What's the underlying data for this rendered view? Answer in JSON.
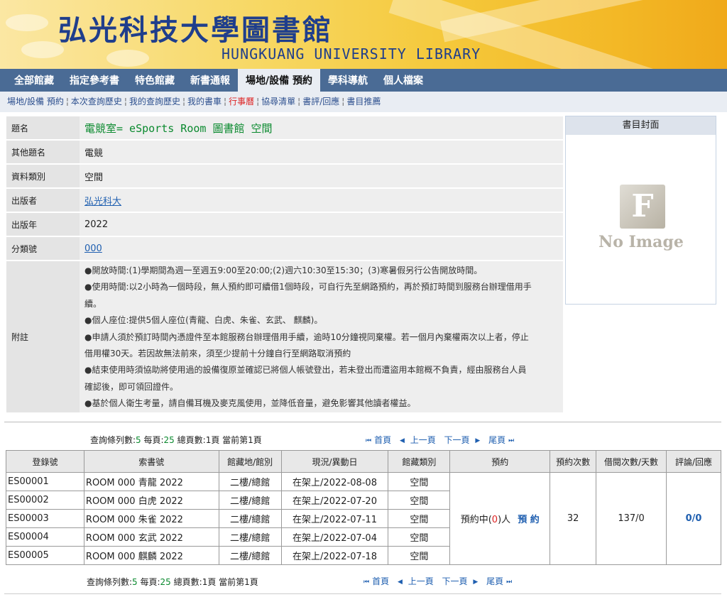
{
  "banner": {
    "title": "弘光科技大學圖書館",
    "subtitle": "HUNGKUANG UNIVERSITY LIBRARY"
  },
  "main_nav": [
    "全部館藏",
    "指定參考書",
    "特色館藏",
    "新書通報",
    "場地/設備 預約",
    "學科導航",
    "個人檔案"
  ],
  "sub_nav": [
    "場地/設備 預約",
    "本次查詢歷史",
    "我的查詢歷史",
    "我的書車",
    "行事曆",
    "協尋清單",
    "書評/回應",
    "書目推薦"
  ],
  "record": {
    "title_label": "題名",
    "title": "電競室= eSports Room 圖書館 空間",
    "other_title_label": "其他題名",
    "other_title": "電競",
    "type_label": "資料類別",
    "type": "空間",
    "publisher_label": "出版者",
    "publisher": "弘光科大",
    "year_label": "出版年",
    "year": "2022",
    "class_label": "分類號",
    "class_no": "000",
    "note_label": "附註",
    "notes": [
      "●開放時間:(1)學期間為週一至週五9:00至20:00;(2)週六10:30至15:30；(3)寒暑假另行公告開放時間。",
      "●使用時間:以2小時為一個時段，無人預約即可續借1個時段，可自行先至網路預約，再於預訂時間到服務台辦理借用手",
      "續。",
      "●個人座位:提供5個人座位(青龍、白虎、朱雀、玄武、 麒麟)。",
      "●申請人須於預訂時間內憑證件至本館服務台辦理借用手續，逾時10分鐘視同棄權。若一個月內棄權兩次以上者，停止",
      "借用權30天。若因故無法前來，須至少提前十分鐘自行至網路取消預約",
      "●結束使用時須協助將使用過的設備復原並確認已將個人帳號登出，若未登出而遭盜用本館概不負責，經由服務台人員",
      "確認後，即可領回證件。",
      "●基於個人衛生考量，請自備耳機及麥克風使用，並降低音量，避免影響其他讀者權益。"
    ]
  },
  "cover": {
    "header": "書目封面",
    "placeholder_letter": "F",
    "placeholder_text": "No Image"
  },
  "pager": {
    "rows_label": "查詢條列數:",
    "rows": "5",
    "per_page_label": " 每頁:",
    "per_page": "25",
    "pages_label": " 總頁數:",
    "pages": "1",
    "current_label_a": "頁 當前第",
    "current": "1",
    "current_label_b": "頁",
    "first": "首頁",
    "prev": "上一頁",
    "next": "下一頁",
    "last": "尾頁"
  },
  "holdings": {
    "headers": [
      "登錄號",
      "索書號",
      "館藏地/館別",
      "現況/異動日",
      "館藏類別",
      "預約",
      "預約次數",
      "借閱次數/天數",
      "評論/回應"
    ],
    "rows": [
      [
        "ES00001",
        "ROOM 000 青龍 2022",
        "二樓/總館",
        "在架上/2022-08-08",
        "空間"
      ],
      [
        "ES00002",
        "ROOM 000 白虎 2022",
        "二樓/總館",
        "在架上/2022-07-20",
        "空間"
      ],
      [
        "ES00003",
        "ROOM 000 朱雀 2022",
        "二樓/總館",
        "在架上/2022-07-11",
        "空間"
      ],
      [
        "ES00004",
        "ROOM 000 玄武 2022",
        "二樓/總館",
        "在架上/2022-07-04",
        "空間"
      ],
      [
        "ES00005",
        "ROOM 000 麒麟 2022",
        "二樓/總館",
        "在架上/2022-07-18",
        "空間"
      ]
    ],
    "reserve_prefix": "預約中(",
    "reserve_count": "0",
    "reserve_suffix": ")人",
    "reserve_link": "預 約",
    "reserve_times": "32",
    "loan_stats": "137/0",
    "reviews": "0/0"
  }
}
